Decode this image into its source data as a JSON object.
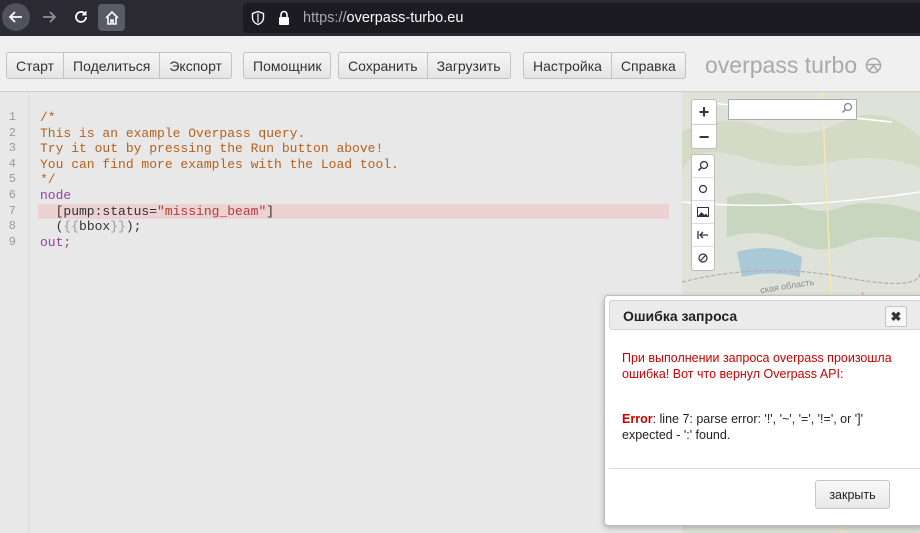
{
  "browser": {
    "url_protocol": "https://",
    "url_host": "overpass-turbo.eu"
  },
  "toolbar": {
    "groups": [
      [
        "Старт",
        "Поделиться",
        "Экспорт"
      ],
      [
        "Помощник"
      ],
      [
        "Сохранить",
        "Загрузить"
      ],
      [
        "Настройка",
        "Справка"
      ]
    ],
    "brand": "overpass turbo"
  },
  "editor": {
    "line_numbers": [
      "1",
      "2",
      "3",
      "4",
      "5",
      "6",
      "7",
      "8",
      "9"
    ],
    "lines": [
      {
        "text": "/*",
        "style": "comment"
      },
      {
        "text": "This is an example Overpass query.",
        "style": "comment"
      },
      {
        "text": "Try it out by pressing the Run button above!",
        "style": "comment"
      },
      {
        "text": "You can find more examples with the Load tool.",
        "style": "comment"
      },
      {
        "text": "*/",
        "style": "comment"
      },
      {
        "text": "node",
        "style": "keyword"
      },
      {
        "text": "  [pump:status=\"missing_beam\"]",
        "style": "error"
      },
      {
        "text": "  ({{bbox}});",
        "style": "bbox"
      },
      {
        "text": "out;",
        "style": "keyword"
      }
    ]
  },
  "map": {
    "zoom_in": "+",
    "zoom_out": "−",
    "region_label": "ская область"
  },
  "dialog": {
    "title": "Ошибка запроса",
    "close_symbol": "✖",
    "message": "При выполнении запроса overpass произошла ошибка! Вот что вернул Overpass API:",
    "error_label": "Error",
    "error_text": ": line 7: parse error: '!', '~', '=', '!=', or ']' expected - ':' found.",
    "button": "закрыть"
  },
  "colors": {
    "error_text": "#cc0000",
    "error_line_highlight": "#ecd2d2",
    "comment": "#b5611e",
    "keyword": "#9a3f9a"
  }
}
